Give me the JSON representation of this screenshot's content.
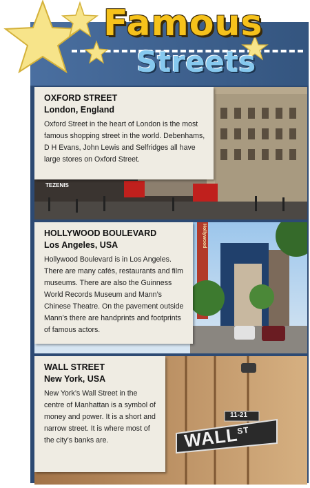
{
  "header": {
    "title_line1": "Famous",
    "title_line2": "Streets"
  },
  "sections": [
    {
      "name": "OXFORD STREET",
      "location": "London, England",
      "text": "Oxford Street in the heart of London is the most famous shopping street in the world. Debenhams, D H Evans, John Lewis and Selfridges all have large stores on Oxford Street.",
      "photo_signs": [
        "TEZENIS"
      ]
    },
    {
      "name": "HOLLYWOOD BOULEVARD",
      "location": "Los Angeles, USA",
      "text": "Hollywood Boulevard is in Los Angeles. There are many cafés, restaurants and film museums. There are also the Guinness World Records Museum and Mann’s Chinese Theatre. On the pavement outside Mann’s there are handprints and footprints of famous actors.",
      "photo_signs": [
        "Hollywood"
      ]
    },
    {
      "name": "WALL STREET",
      "location": "New York, USA",
      "text": "New York’s Wall Street in the centre of Manhattan is a symbol of money and power. It is a short and narrow street. It is where most of the city’s banks are.",
      "photo_signs": [
        "11-21",
        "WALL",
        "ST"
      ]
    }
  ]
}
